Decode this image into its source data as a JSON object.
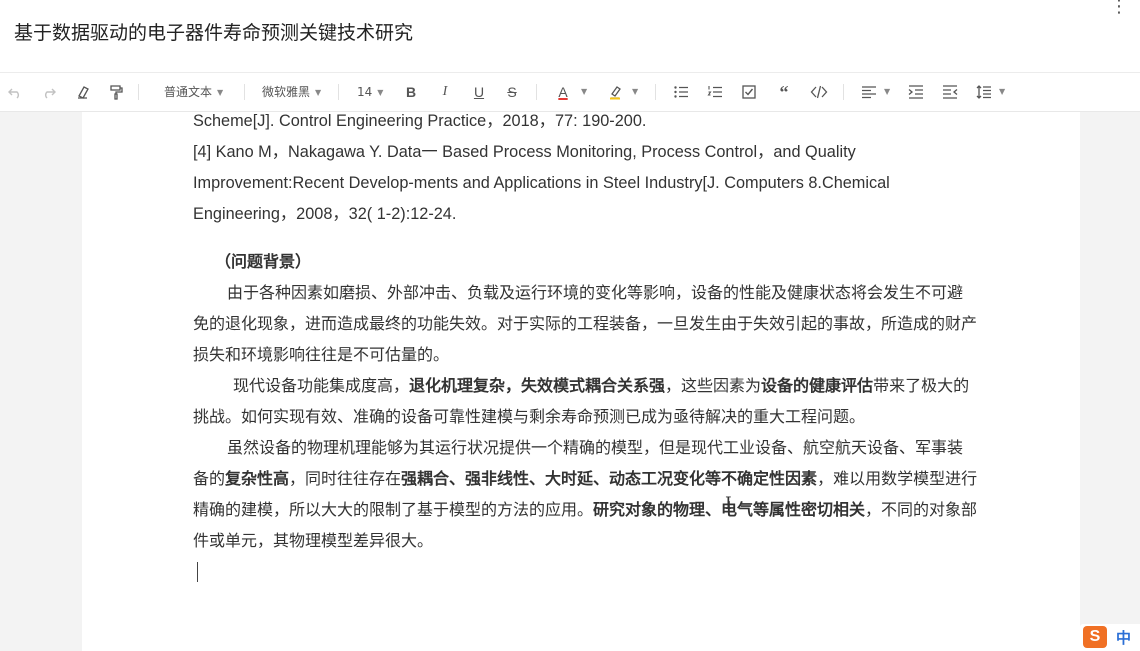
{
  "document": {
    "title": "基于数据驱动的电子器件寿命预测关键技术研究"
  },
  "toolbar": {
    "paragraph_style": "普通文本",
    "font_family": "微软雅黑",
    "font_size": "14",
    "bold": "B",
    "italic": "I",
    "underline": "U",
    "strike": "S",
    "font_color": "A"
  },
  "content": {
    "ref3_tail": "Scheme[J]. Control Engineering Practice，2018，77: 190-200.",
    "ref4_line1": "[4] Kano M，Nakagawa Y. Data一 Based Process Monitoring, Process Control，and Quality",
    "ref4_line2": "Improvement:Recent Develop-ments and Applications in Steel Industry[J. Computers 8.Chemical",
    "ref4_line3": "Engineering，2008，32( 1-2):12-24.",
    "heading": "（问题背景）",
    "p1": "由于各种因素如磨损、外部冲击、负载及运行环境的变化等影响，设备的性能及健康状态将会发生不可避免的退化现象，进而造成最终的功能失效。对于实际的工程装备，一旦发生由于失效引起的事故，所造成的财产损失和环境影响往往是不可估量的。",
    "p2_a": "现代设备功能集成度高，",
    "p2_b": "退化机理复杂，失效模式耦合关系强",
    "p2_c": "，这些因素为",
    "p2_d": "设备的健康评估",
    "p2_e": "带来了极大的挑战。如何实现有效、准确的设备可靠性建模与剩余寿命预测已成为亟待解决的重大工程问题。",
    "p3_a": "虽然设备的物理机理能够为其运行状况提供一个精确的模型，但是现代工业设备、航空航天设备、军事装备的",
    "p3_b": "复杂性高",
    "p3_c": "，同时往往存在",
    "p3_d": "强耦合、强非线性、大时延、动态工况变化等不确定性因素",
    "p3_e": "，难以用数学模型进行精确的建模，所以大大的限制了基于模型的方法的应用。",
    "p3_f": "研究对象的物理、电气等属性密切相关",
    "p3_g": "，不同的对象部件或单元，其物理模型差异很大。"
  },
  "ime": {
    "logo": "S",
    "mode": "中"
  }
}
